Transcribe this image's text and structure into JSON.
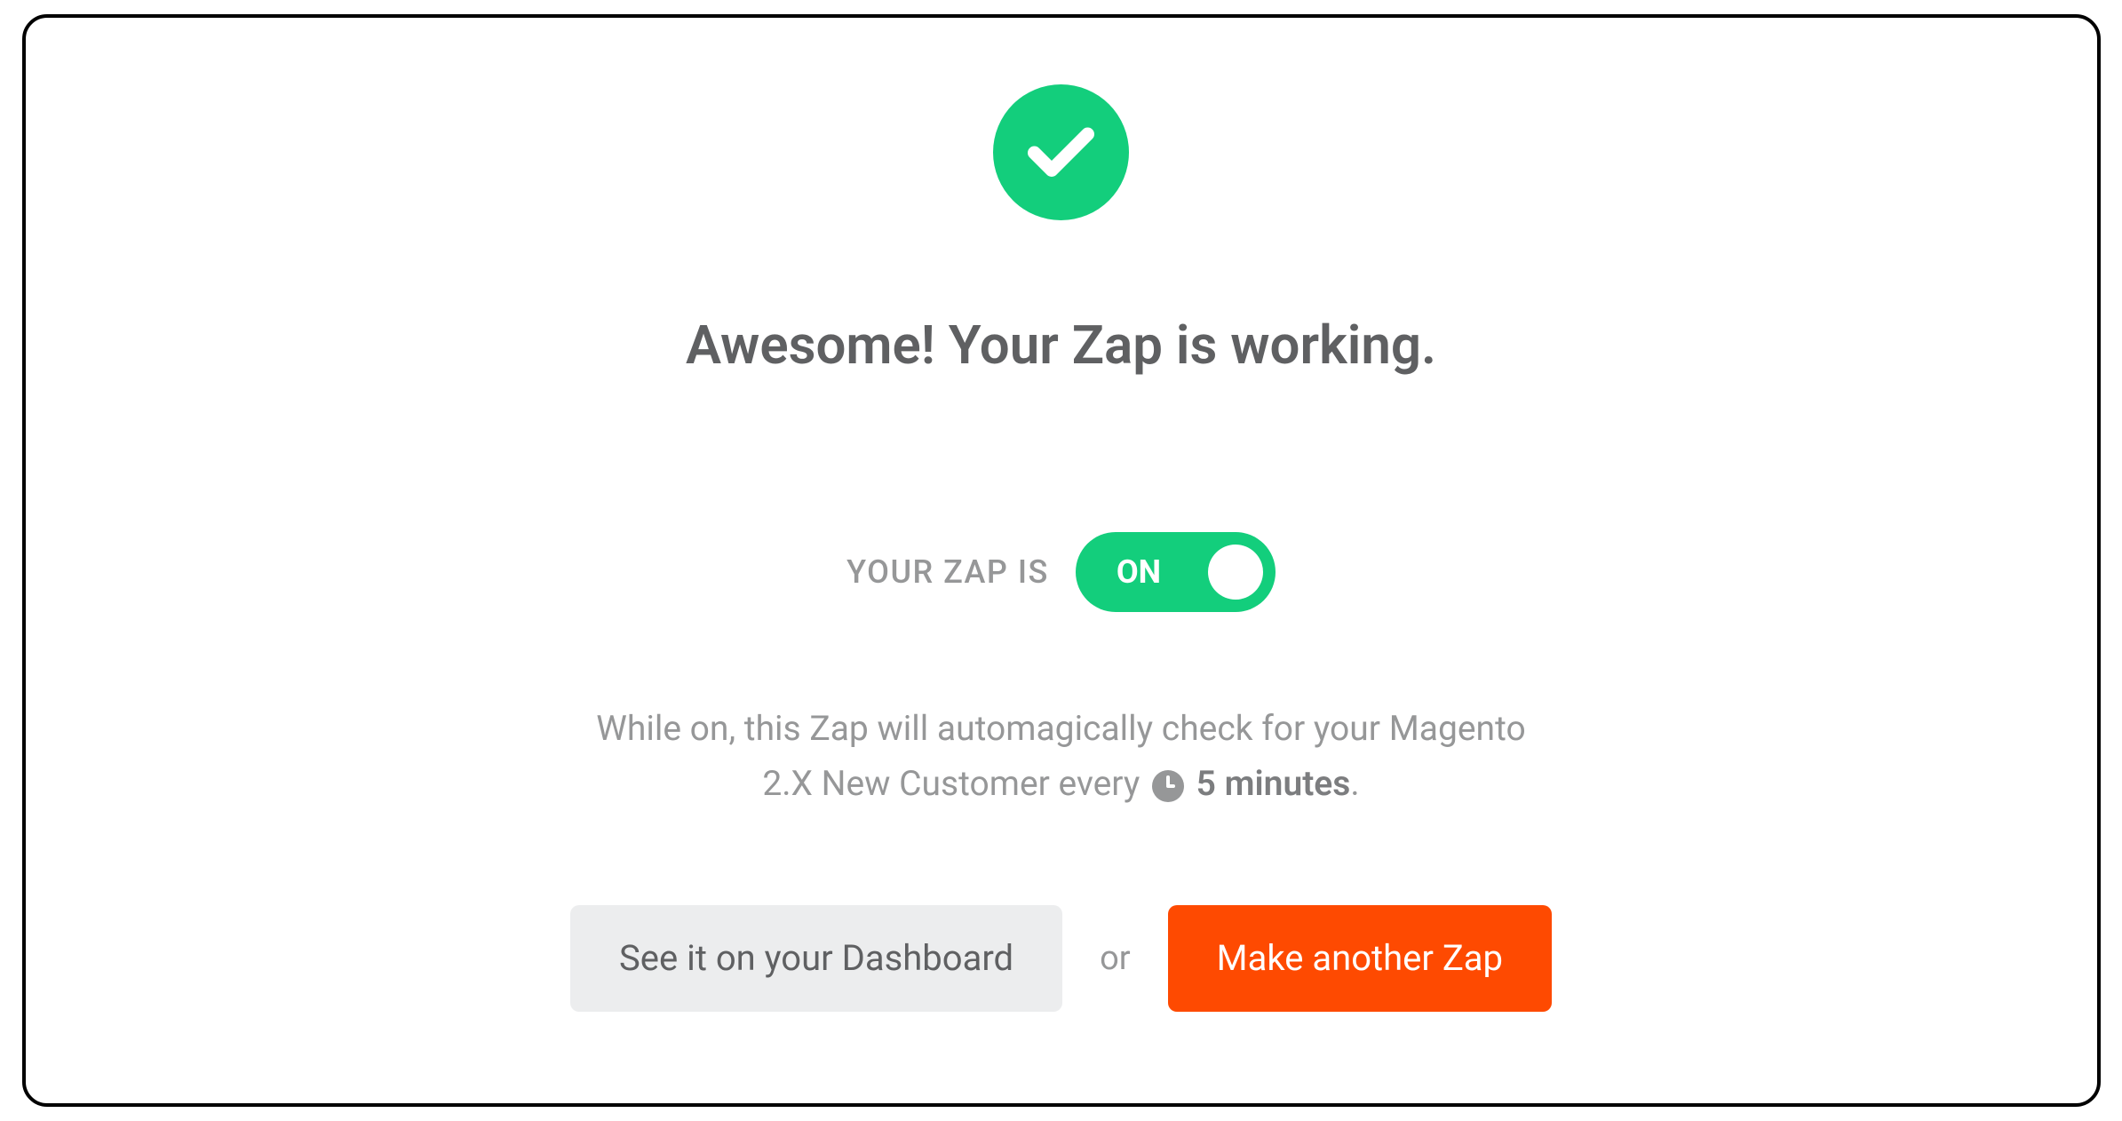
{
  "heading": "Awesome! Your Zap is working.",
  "toggle": {
    "label": "YOUR ZAP IS",
    "state_text": "ON"
  },
  "description": {
    "line1_prefix": "While on, this Zap will automagically check for your Magento",
    "line2_prefix": "2.X New Customer every ",
    "interval": "5 minutes",
    "period": "."
  },
  "buttons": {
    "dashboard": "See it on your Dashboard",
    "or": "or",
    "make_another": "Make another Zap"
  }
}
